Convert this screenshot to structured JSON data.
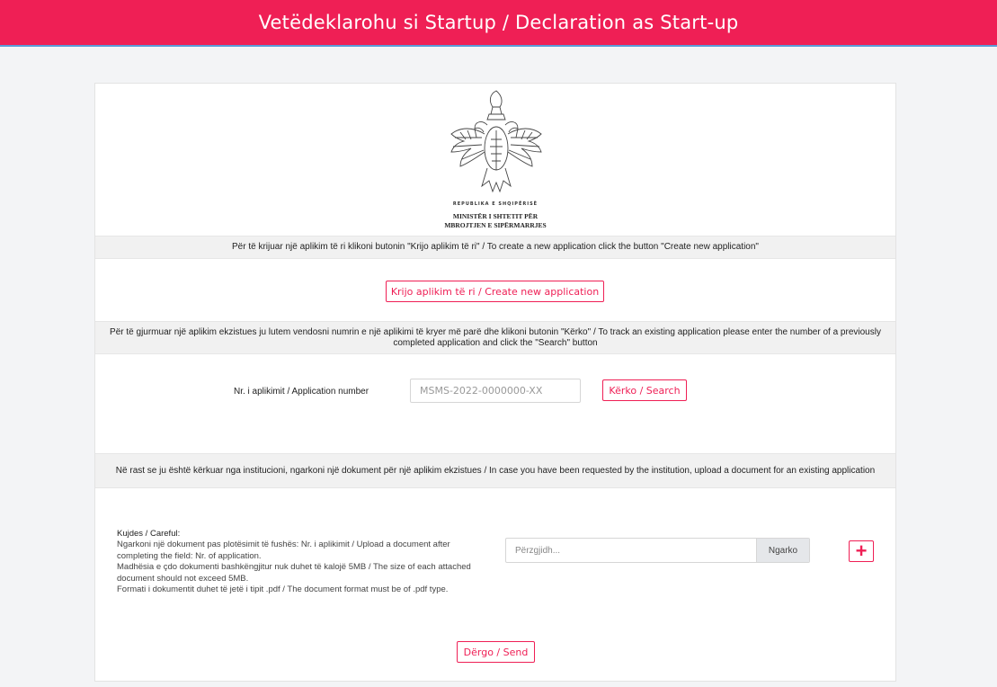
{
  "header": {
    "title": "Vetëdeklarohu si Startup / Declaration as Start-up"
  },
  "emblem": {
    "line1": "REPUBLIKA E SHQIPËRISË",
    "line2": "MINISTËR I SHTETIT PËR",
    "line3": "MBROJTJEN E SIPËRMARRJES"
  },
  "create": {
    "instruction": "Për të krijuar një aplikim të ri klikoni butonin \"Krijo aplikim të ri\" / To create a new application click the button \"Create new application\"",
    "button_label": "Krijo aplikim të ri / Create new application"
  },
  "track": {
    "instruction": "Për të gjurmuar një aplikim ekzistues ju lutem vendosni numrin e një aplikimi të kryer më parë dhe klikoni butonin \"Kërko\" / To track an existing application please enter the number of a previously completed application and click the \"Search\" button",
    "field_label": "Nr. i aplikimit / Application number",
    "placeholder": "MSMS-2022-0000000-XX",
    "search_label": "Kërko / Search"
  },
  "upload": {
    "instruction": "Në rast se ju është kërkuar nga institucioni, ngarkoni një dokument për një aplikim ekzistues / In case you have been requested by the institution, upload a document for an existing application",
    "careful_title": "Kujdes / Careful:",
    "note1": "Ngarkoni një dokument pas plotësimit të fushës: Nr. i aplikimit / Upload a document after completing the field: Nr. of application.",
    "note2": "Madhësia e çdo dokumenti bashkëngjitur nuk duhet të kalojë 5MB / The size of each attached document should not exceed 5MB.",
    "note3": "Formati i dokumentit duhet të jetë i tipit .pdf / The document format must be of .pdf type.",
    "file_placeholder": "Përzgjidh...",
    "upload_button": "Ngarko",
    "send_label": "Dërgo / Send"
  },
  "colors": {
    "accent": "#ef1f55",
    "header_border": "#5a9bd8"
  }
}
